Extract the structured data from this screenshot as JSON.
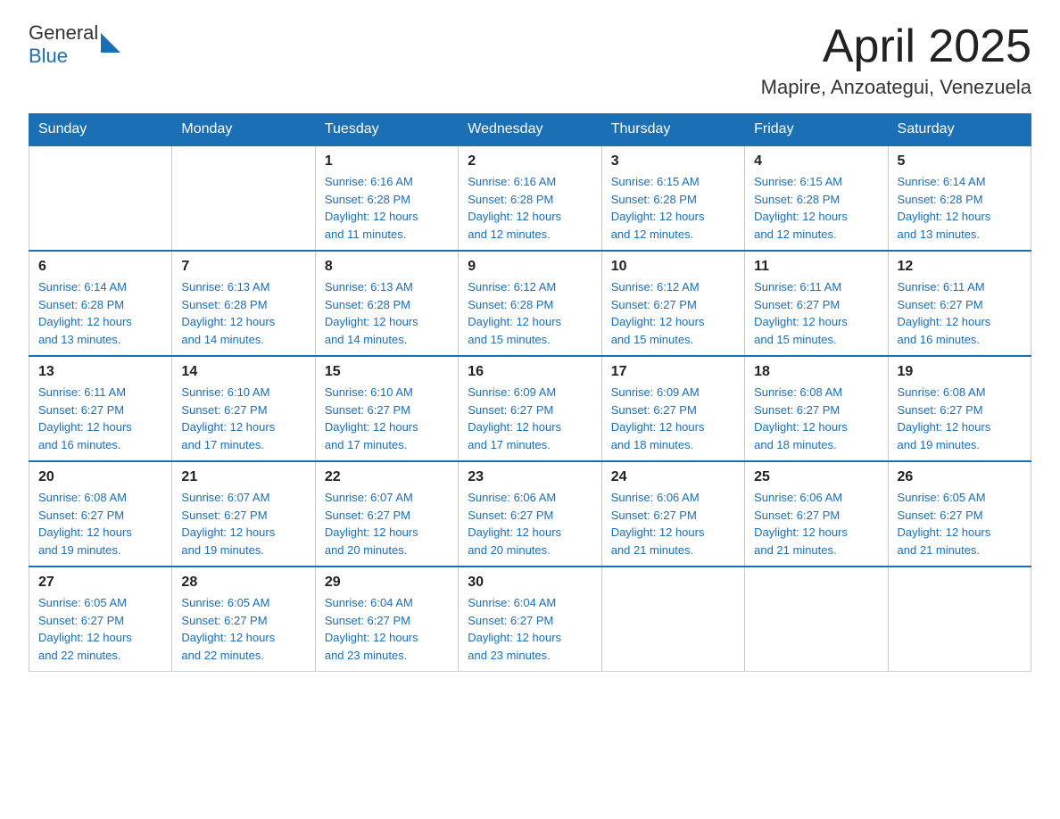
{
  "header": {
    "logo_general": "General",
    "logo_blue": "Blue",
    "month_year": "April 2025",
    "location": "Mapire, Anzoategui, Venezuela"
  },
  "days_of_week": [
    "Sunday",
    "Monday",
    "Tuesday",
    "Wednesday",
    "Thursday",
    "Friday",
    "Saturday"
  ],
  "weeks": [
    [
      {
        "day": "",
        "info": ""
      },
      {
        "day": "",
        "info": ""
      },
      {
        "day": "1",
        "info": "Sunrise: 6:16 AM\nSunset: 6:28 PM\nDaylight: 12 hours\nand 11 minutes."
      },
      {
        "day": "2",
        "info": "Sunrise: 6:16 AM\nSunset: 6:28 PM\nDaylight: 12 hours\nand 12 minutes."
      },
      {
        "day": "3",
        "info": "Sunrise: 6:15 AM\nSunset: 6:28 PM\nDaylight: 12 hours\nand 12 minutes."
      },
      {
        "day": "4",
        "info": "Sunrise: 6:15 AM\nSunset: 6:28 PM\nDaylight: 12 hours\nand 12 minutes."
      },
      {
        "day": "5",
        "info": "Sunrise: 6:14 AM\nSunset: 6:28 PM\nDaylight: 12 hours\nand 13 minutes."
      }
    ],
    [
      {
        "day": "6",
        "info": "Sunrise: 6:14 AM\nSunset: 6:28 PM\nDaylight: 12 hours\nand 13 minutes."
      },
      {
        "day": "7",
        "info": "Sunrise: 6:13 AM\nSunset: 6:28 PM\nDaylight: 12 hours\nand 14 minutes."
      },
      {
        "day": "8",
        "info": "Sunrise: 6:13 AM\nSunset: 6:28 PM\nDaylight: 12 hours\nand 14 minutes."
      },
      {
        "day": "9",
        "info": "Sunrise: 6:12 AM\nSunset: 6:28 PM\nDaylight: 12 hours\nand 15 minutes."
      },
      {
        "day": "10",
        "info": "Sunrise: 6:12 AM\nSunset: 6:27 PM\nDaylight: 12 hours\nand 15 minutes."
      },
      {
        "day": "11",
        "info": "Sunrise: 6:11 AM\nSunset: 6:27 PM\nDaylight: 12 hours\nand 15 minutes."
      },
      {
        "day": "12",
        "info": "Sunrise: 6:11 AM\nSunset: 6:27 PM\nDaylight: 12 hours\nand 16 minutes."
      }
    ],
    [
      {
        "day": "13",
        "info": "Sunrise: 6:11 AM\nSunset: 6:27 PM\nDaylight: 12 hours\nand 16 minutes."
      },
      {
        "day": "14",
        "info": "Sunrise: 6:10 AM\nSunset: 6:27 PM\nDaylight: 12 hours\nand 17 minutes."
      },
      {
        "day": "15",
        "info": "Sunrise: 6:10 AM\nSunset: 6:27 PM\nDaylight: 12 hours\nand 17 minutes."
      },
      {
        "day": "16",
        "info": "Sunrise: 6:09 AM\nSunset: 6:27 PM\nDaylight: 12 hours\nand 17 minutes."
      },
      {
        "day": "17",
        "info": "Sunrise: 6:09 AM\nSunset: 6:27 PM\nDaylight: 12 hours\nand 18 minutes."
      },
      {
        "day": "18",
        "info": "Sunrise: 6:08 AM\nSunset: 6:27 PM\nDaylight: 12 hours\nand 18 minutes."
      },
      {
        "day": "19",
        "info": "Sunrise: 6:08 AM\nSunset: 6:27 PM\nDaylight: 12 hours\nand 19 minutes."
      }
    ],
    [
      {
        "day": "20",
        "info": "Sunrise: 6:08 AM\nSunset: 6:27 PM\nDaylight: 12 hours\nand 19 minutes."
      },
      {
        "day": "21",
        "info": "Sunrise: 6:07 AM\nSunset: 6:27 PM\nDaylight: 12 hours\nand 19 minutes."
      },
      {
        "day": "22",
        "info": "Sunrise: 6:07 AM\nSunset: 6:27 PM\nDaylight: 12 hours\nand 20 minutes."
      },
      {
        "day": "23",
        "info": "Sunrise: 6:06 AM\nSunset: 6:27 PM\nDaylight: 12 hours\nand 20 minutes."
      },
      {
        "day": "24",
        "info": "Sunrise: 6:06 AM\nSunset: 6:27 PM\nDaylight: 12 hours\nand 21 minutes."
      },
      {
        "day": "25",
        "info": "Sunrise: 6:06 AM\nSunset: 6:27 PM\nDaylight: 12 hours\nand 21 minutes."
      },
      {
        "day": "26",
        "info": "Sunrise: 6:05 AM\nSunset: 6:27 PM\nDaylight: 12 hours\nand 21 minutes."
      }
    ],
    [
      {
        "day": "27",
        "info": "Sunrise: 6:05 AM\nSunset: 6:27 PM\nDaylight: 12 hours\nand 22 minutes."
      },
      {
        "day": "28",
        "info": "Sunrise: 6:05 AM\nSunset: 6:27 PM\nDaylight: 12 hours\nand 22 minutes."
      },
      {
        "day": "29",
        "info": "Sunrise: 6:04 AM\nSunset: 6:27 PM\nDaylight: 12 hours\nand 23 minutes."
      },
      {
        "day": "30",
        "info": "Sunrise: 6:04 AM\nSunset: 6:27 PM\nDaylight: 12 hours\nand 23 minutes."
      },
      {
        "day": "",
        "info": ""
      },
      {
        "day": "",
        "info": ""
      },
      {
        "day": "",
        "info": ""
      }
    ]
  ]
}
